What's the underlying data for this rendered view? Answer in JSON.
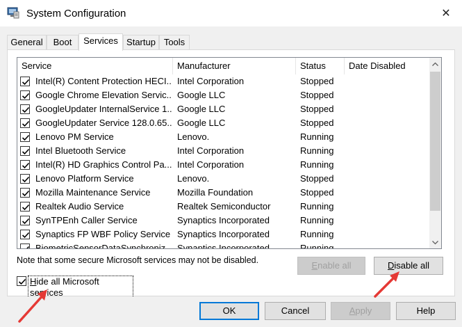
{
  "window": {
    "title": "System Configuration",
    "icon": "msconfig-icon",
    "close_glyph": "✕"
  },
  "tabs": [
    {
      "label": "General",
      "active": false
    },
    {
      "label": "Boot",
      "active": false
    },
    {
      "label": "Services",
      "active": true
    },
    {
      "label": "Startup",
      "active": false
    },
    {
      "label": "Tools",
      "active": false
    }
  ],
  "services": {
    "columns": [
      "Service",
      "Manufacturer",
      "Status",
      "Date Disabled"
    ],
    "rows": [
      {
        "name": "Intel(R) Content Protection HECI...",
        "manufacturer": "Intel Corporation",
        "status": "Stopped",
        "date_disabled": "",
        "checked": true
      },
      {
        "name": "Google Chrome Elevation Servic...",
        "manufacturer": "Google LLC",
        "status": "Stopped",
        "date_disabled": "",
        "checked": true
      },
      {
        "name": "GoogleUpdater InternalService 1...",
        "manufacturer": "Google LLC",
        "status": "Stopped",
        "date_disabled": "",
        "checked": true
      },
      {
        "name": "GoogleUpdater Service 128.0.65...",
        "manufacturer": "Google LLC",
        "status": "Stopped",
        "date_disabled": "",
        "checked": true
      },
      {
        "name": "Lenovo PM Service",
        "manufacturer": "Lenovo.",
        "status": "Running",
        "date_disabled": "",
        "checked": true
      },
      {
        "name": "Intel Bluetooth Service",
        "manufacturer": "Intel Corporation",
        "status": "Running",
        "date_disabled": "",
        "checked": true
      },
      {
        "name": "Intel(R) HD Graphics Control Pa...",
        "manufacturer": "Intel Corporation",
        "status": "Running",
        "date_disabled": "",
        "checked": true
      },
      {
        "name": "Lenovo Platform Service",
        "manufacturer": "Lenovo.",
        "status": "Stopped",
        "date_disabled": "",
        "checked": true
      },
      {
        "name": "Mozilla Maintenance Service",
        "manufacturer": "Mozilla Foundation",
        "status": "Stopped",
        "date_disabled": "",
        "checked": true
      },
      {
        "name": "Realtek Audio Service",
        "manufacturer": "Realtek Semiconductor",
        "status": "Running",
        "date_disabled": "",
        "checked": true
      },
      {
        "name": "SynTPEnh Caller Service",
        "manufacturer": "Synaptics Incorporated",
        "status": "Running",
        "date_disabled": "",
        "checked": true
      },
      {
        "name": "Synaptics FP WBF Policy Service",
        "manufacturer": "Synaptics Incorporated",
        "status": "Running",
        "date_disabled": "",
        "checked": true
      },
      {
        "name": "BiometricSensorDataSynchroniz...",
        "manufacturer": "Synaptics Incorporated",
        "status": "Running",
        "date_disabled": "",
        "checked": true
      }
    ]
  },
  "note": "Note that some secure Microsoft services may not be disabled.",
  "enable_all": {
    "access_key": "E",
    "rest": "nable all",
    "enabled": false
  },
  "disable_all": {
    "access_key": "D",
    "rest": "isable all",
    "enabled": true
  },
  "hide_microsoft": {
    "access_key": "H",
    "rest": "ide all Microsoft services",
    "checked": true
  },
  "footer": {
    "ok": "OK",
    "cancel": "Cancel",
    "apply": {
      "access_key": "A",
      "rest": "pply",
      "enabled": false
    },
    "help": "Help"
  },
  "colors": {
    "accent": "#0078d7",
    "annotation_arrow": "#e53935",
    "panel_bg": "#ffffff",
    "window_bg": "#f0f0f0"
  }
}
